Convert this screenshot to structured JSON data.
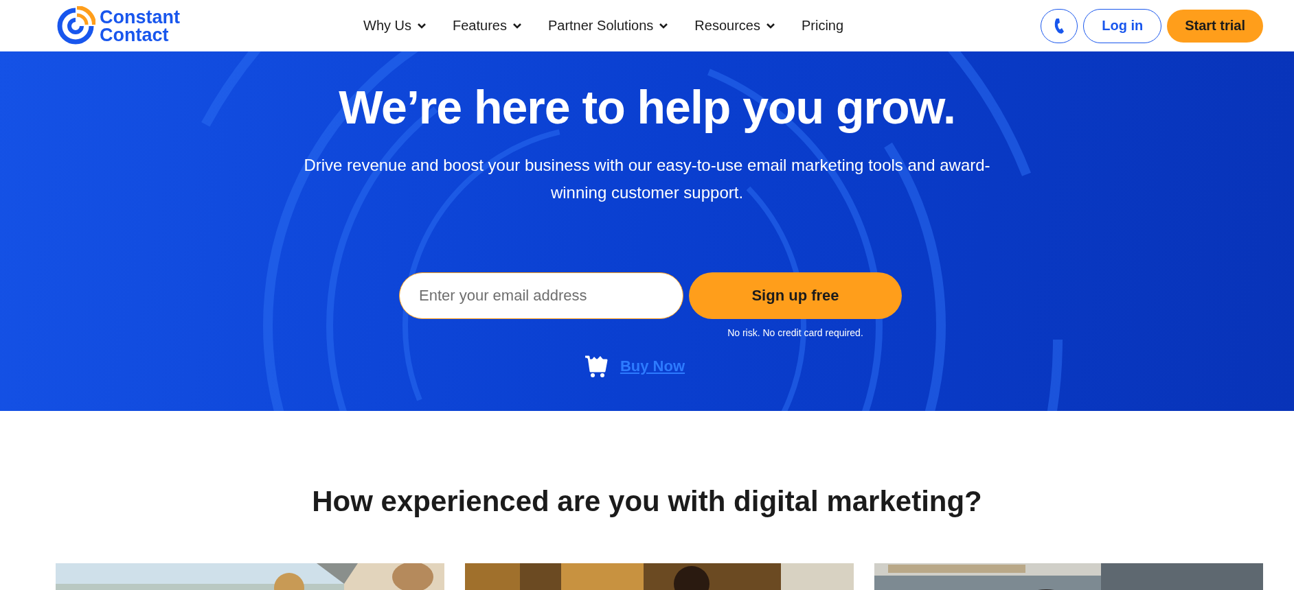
{
  "header": {
    "logo_lines": [
      "Constant",
      "Contact"
    ],
    "nav": [
      {
        "label": "Why Us",
        "has_dropdown": true
      },
      {
        "label": "Features",
        "has_dropdown": true
      },
      {
        "label": "Partner Solutions",
        "has_dropdown": true
      },
      {
        "label": "Resources",
        "has_dropdown": true
      },
      {
        "label": "Pricing",
        "has_dropdown": false
      }
    ],
    "login": "Log in",
    "start_trial": "Start trial"
  },
  "hero": {
    "title": "We’re here to help you grow.",
    "subtitle": "Drive revenue and boost your business with our easy-to-use email marketing tools and award-winning customer support.",
    "email": {
      "placeholder": "Enter your email address"
    },
    "signup": "Sign up free",
    "note": "No risk. No credit card required.",
    "buy_now": "Buy Now"
  },
  "section": {
    "title": "How experienced are you with digital marketing?"
  }
}
